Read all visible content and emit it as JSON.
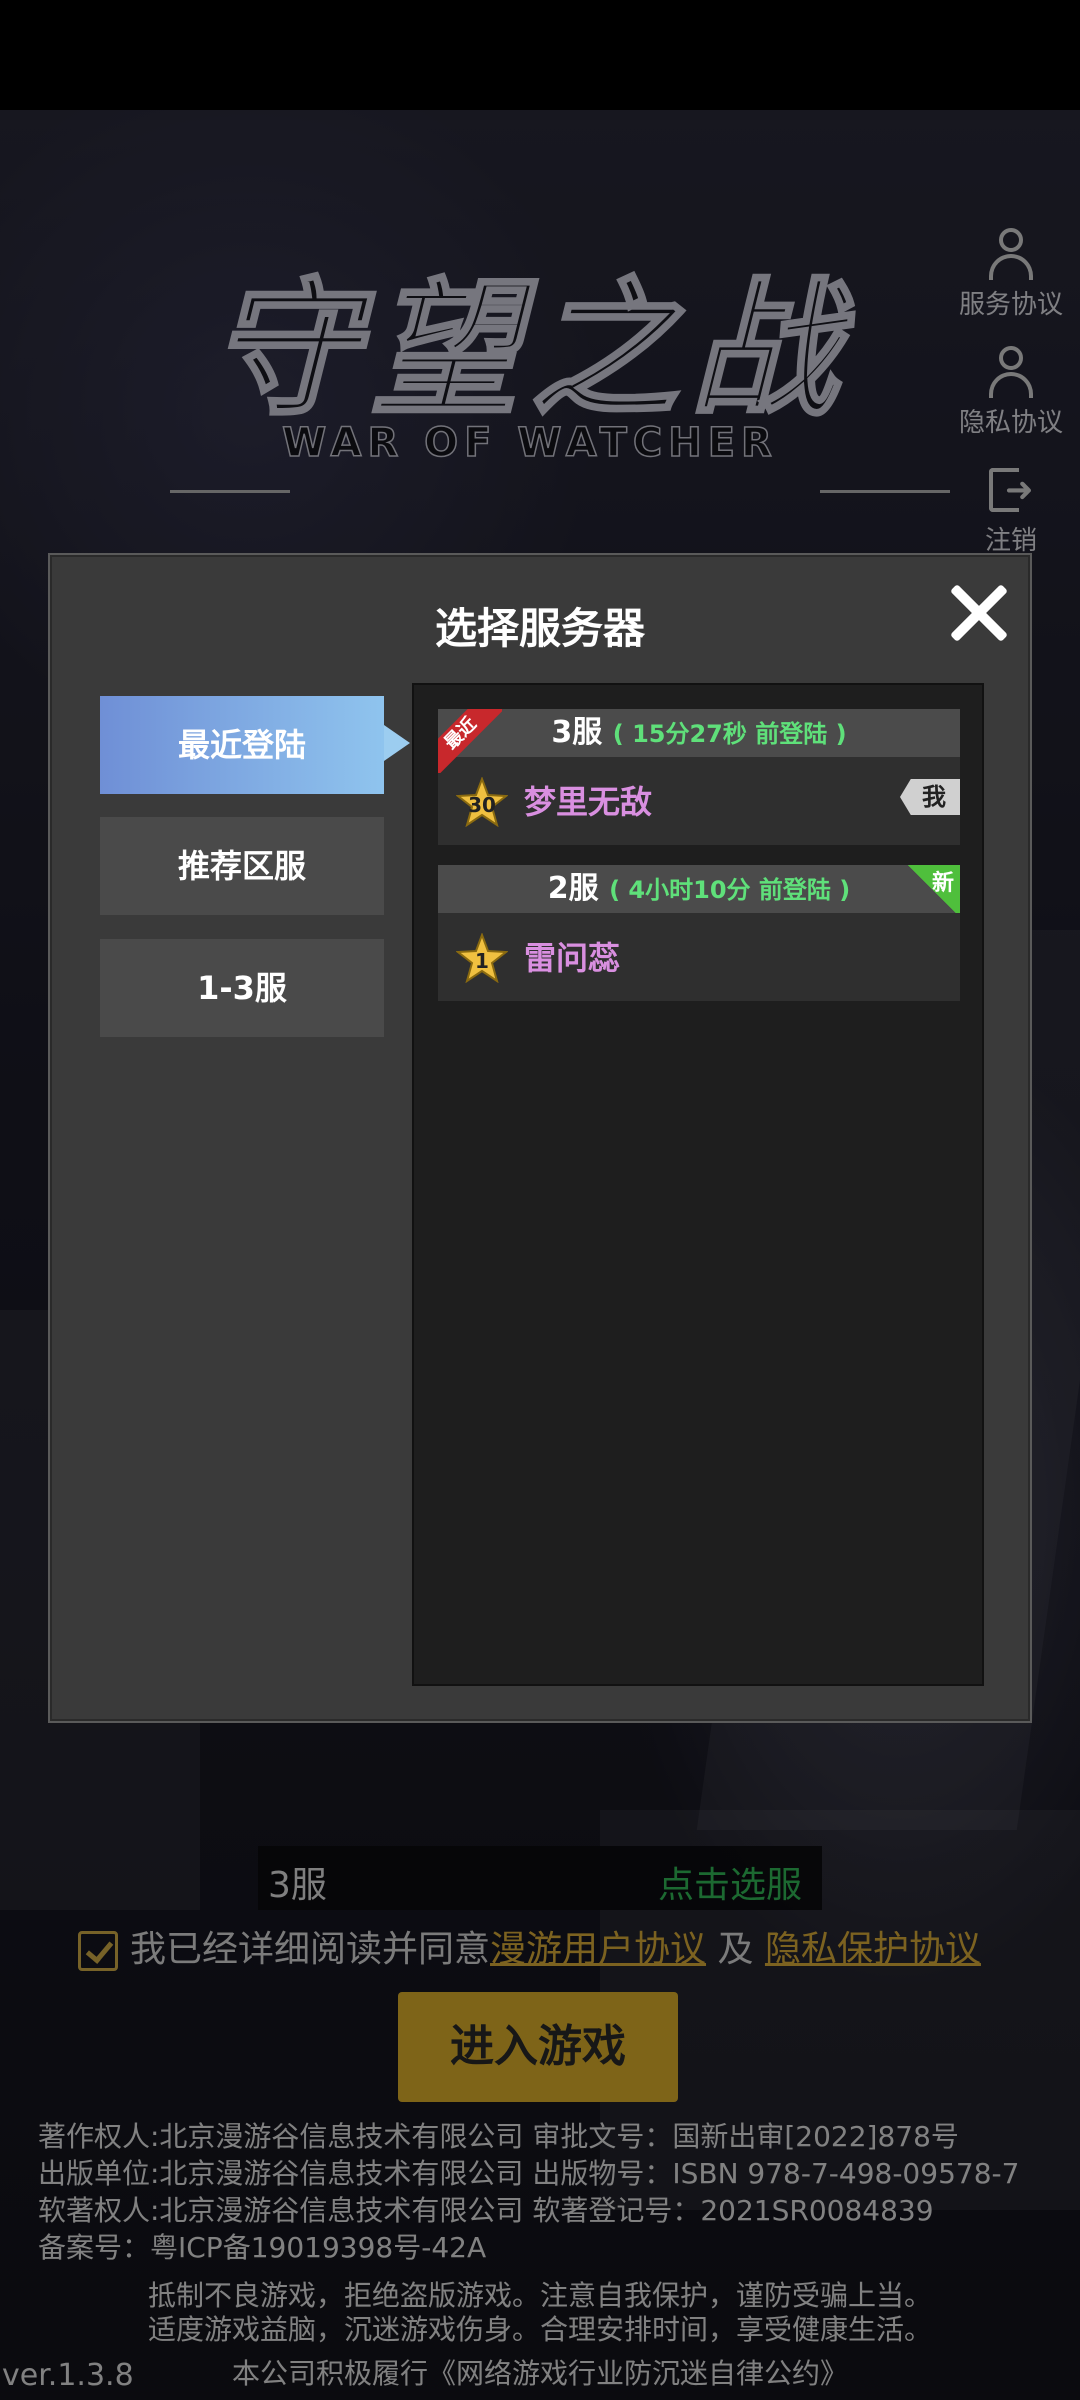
{
  "logo": {
    "title": "守望之战",
    "subtitle": "WAR OF WATCHER"
  },
  "side_buttons": [
    {
      "label": "服务协议",
      "icon": "user-icon"
    },
    {
      "label": "隐私协议",
      "icon": "user-icon"
    },
    {
      "label": "注销",
      "icon": "logout-icon"
    }
  ],
  "dialog": {
    "title": "选择服务器",
    "tabs": [
      {
        "label": "最近登陆",
        "active": true
      },
      {
        "label": "推荐区服",
        "active": false
      },
      {
        "label": "1-3服",
        "active": false
      }
    ],
    "servers": [
      {
        "name": "3服",
        "time": "( 15分27秒 前登陆 )",
        "badge": "最近",
        "player_level": "30",
        "player_name": "梦里无敌",
        "tag": "我"
      },
      {
        "name": "2服",
        "time": "( 4小时10分 前登陆 )",
        "badge": "新",
        "player_level": "1",
        "player_name": "雷问蕊"
      }
    ]
  },
  "server_bar": {
    "current": "3服",
    "action": "点击选服"
  },
  "agreement": {
    "prefix": "我已经详细阅读并同意",
    "link1": "漫游用户协议",
    "and": "及",
    "link2": "隐私保护协议"
  },
  "enter_button": "进入游戏",
  "legal": [
    "著作权人:北京漫游谷信息技术有限公司  审批文号：国新出审[2022]878号",
    "出版单位:北京漫游谷信息技术有限公司  出版物号：ISBN 978-7-498-09578-7",
    "软著权人:北京漫游谷信息技术有限公司  软著登记号：2021SR0084839",
    "备案号：粤ICP备19019398号-42A"
  ],
  "notice": [
    "抵制不良游戏，拒绝盗版游戏。注意自我保护，谨防受骗上当。",
    "适度游戏益脑，沉迷游戏伤身。合理安排时间，享受健康生活。",
    "本公司积极履行《网络游戏行业防沉迷自律公约》"
  ],
  "version": "ver.1.3.8",
  "colors": {
    "accent": "#e6b62c",
    "green": "#33c05a",
    "tab_active": "#7fb0e6",
    "player_name": "#d98fe0"
  }
}
